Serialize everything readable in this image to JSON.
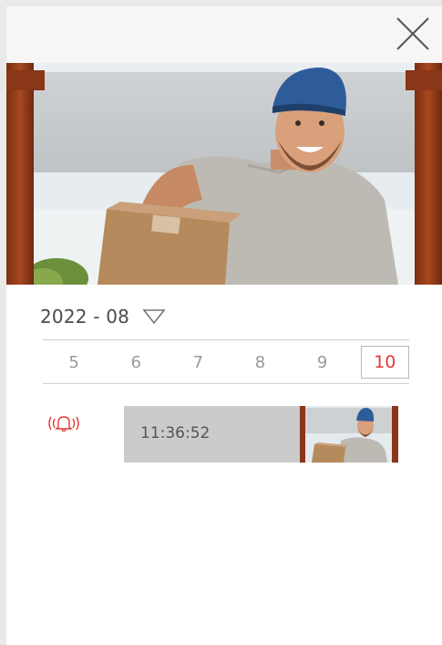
{
  "header": {
    "close_icon": "close-icon"
  },
  "hero": {
    "subject": "delivery person with parcel at door",
    "icon": "camera-snapshot"
  },
  "calendar": {
    "month": "2022 - 08",
    "days": [
      "5",
      "6",
      "7",
      "8",
      "9",
      "10"
    ],
    "selected_day": "10"
  },
  "events": [
    {
      "time": "11:36:52",
      "icon": "doorbell-icon"
    }
  ],
  "colors": {
    "accent": "#e53935",
    "topbar": "#f6f6f6",
    "event_card": "#cbcbcb",
    "cap": "#2e5c9a"
  }
}
